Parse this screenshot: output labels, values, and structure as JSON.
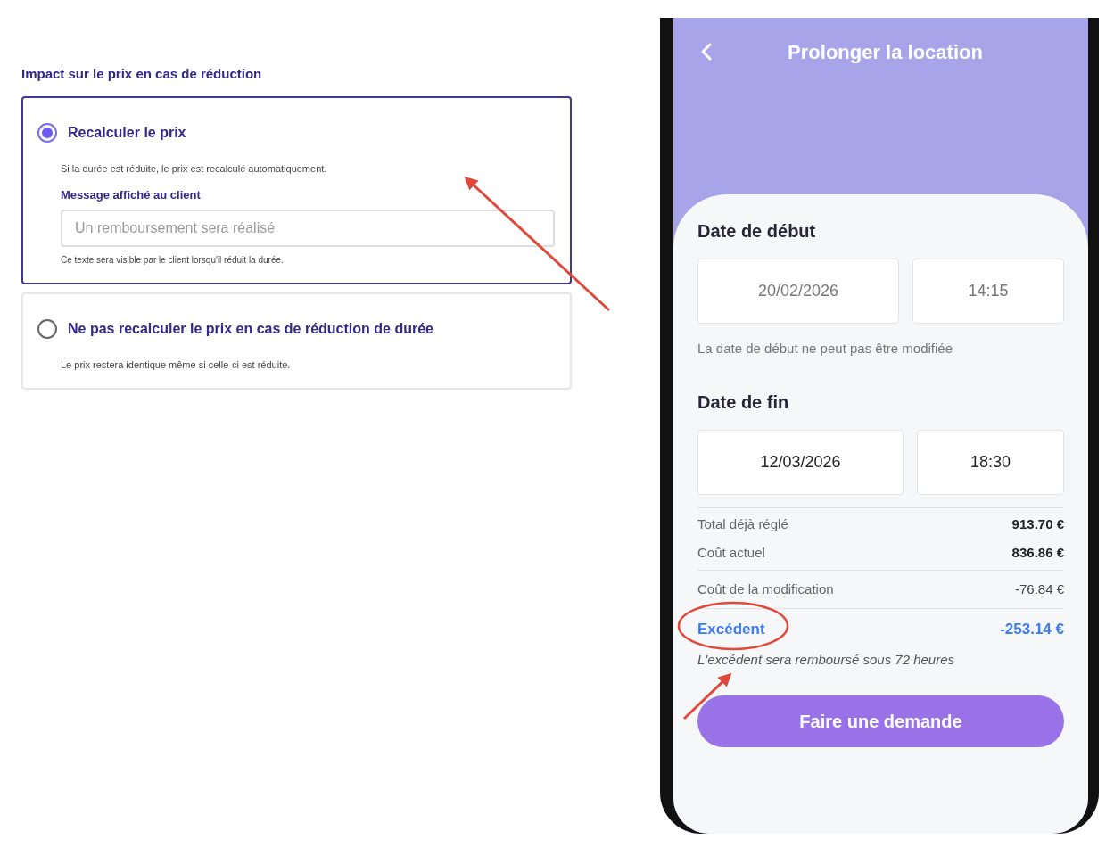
{
  "settings": {
    "title": "Impact sur le prix en cas de réduction",
    "options": [
      {
        "label": "Recalculer le prix",
        "selected": true,
        "description": "Si la durée est réduite, le prix est recalculé automatiquement.",
        "message_field": {
          "label": "Message affiché au client",
          "placeholder": "Un remboursement sera réalisé",
          "help": "Ce texte sera visible par le client lorsqu'il réduit la durée."
        }
      },
      {
        "label": "Ne pas recalculer le prix en cas de réduction de durée",
        "selected": false,
        "description": "Le prix restera identique même si celle-ci est réduite."
      }
    ]
  },
  "phone": {
    "title": "Prolonger la location",
    "date_sections": [
      {
        "heading": "Date de début",
        "date": "20/02/2026",
        "time": "14:15",
        "disabled": true,
        "note": "La date de début ne peut pas être modifiée"
      },
      {
        "heading": "Date de fin",
        "date": "12/03/2026",
        "time": "18:30",
        "disabled": false
      }
    ],
    "summary_sections": [
      {
        "rows": [
          {
            "label": "Total déjà réglé",
            "value": "913.70 €",
            "kind": "strong"
          },
          {
            "label": "Coût actuel",
            "value": "836.86 €",
            "kind": "strong"
          }
        ]
      },
      {
        "rows": [
          {
            "label": "Coût de la modification",
            "value": "-76.84 €",
            "kind": "plain"
          }
        ]
      },
      {
        "rows": [
          {
            "label": "Excédent",
            "value": "-253.14 €",
            "kind": "highlight"
          }
        ]
      }
    ],
    "refund_note": "L'excédent sera remboursé sous 72 heures",
    "button": "Faire une demande"
  }
}
